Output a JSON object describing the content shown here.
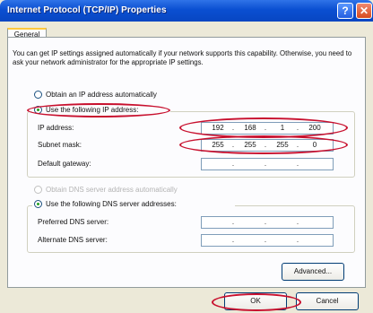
{
  "window": {
    "title": "Internet Protocol (TCP/IP) Properties",
    "help_glyph": "?",
    "close_glyph": "✕"
  },
  "tabs": [
    {
      "label": "General",
      "selected": true
    }
  ],
  "intro_text": "You can get IP settings assigned automatically if your network supports this capability. Otherwise, you need to ask your network administrator for the appropriate IP settings.",
  "ip_mode": {
    "auto_label": "Obtain an IP address automatically",
    "manual_label": "Use the following IP address:",
    "selected": "manual"
  },
  "ip_fields": {
    "ip_address": {
      "label": "IP address:",
      "octets": [
        "192",
        "168",
        "1",
        "200"
      ]
    },
    "subnet_mask": {
      "label": "Subnet mask:",
      "octets": [
        "255",
        "255",
        "255",
        "0"
      ]
    },
    "default_gateway": {
      "label": "Default gateway:",
      "octets": [
        "",
        "",
        "",
        ""
      ]
    }
  },
  "dns_mode": {
    "auto_label": "Obtain DNS server address automatically",
    "manual_label": "Use the following DNS server addresses:",
    "selected": "manual"
  },
  "dns_fields": {
    "preferred": {
      "label": "Preferred DNS server:",
      "octets": [
        "",
        "",
        "",
        ""
      ]
    },
    "alternate": {
      "label": "Alternate DNS server:",
      "octets": [
        "",
        "",
        "",
        ""
      ]
    }
  },
  "buttons": {
    "advanced": "Advanced...",
    "ok": "OK",
    "cancel": "Cancel"
  },
  "colors": {
    "title_bar": "#0a4fd1",
    "annotation": "#c8102e",
    "radio_dot": "#21a121"
  }
}
